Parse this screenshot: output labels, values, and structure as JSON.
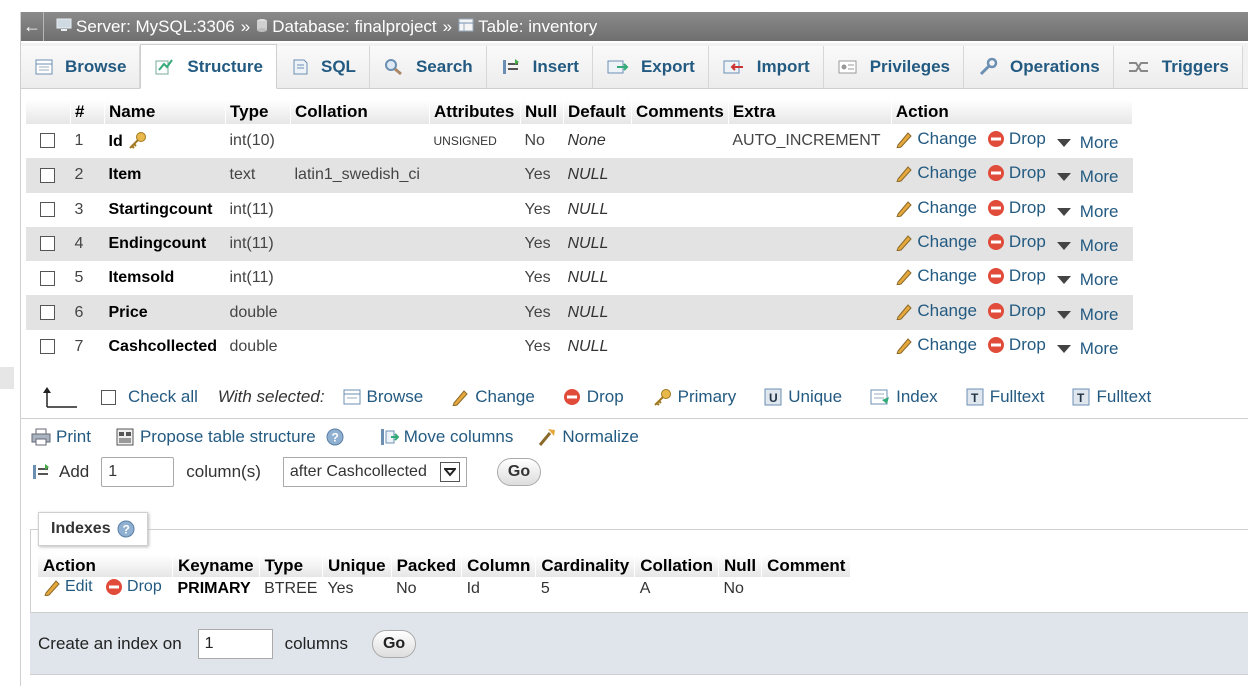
{
  "breadcrumb": {
    "back_arrow": "←",
    "server": "Server: MySQL:3306",
    "database": "Database: finalproject",
    "table": "Table: inventory",
    "separator": "»"
  },
  "tabs": [
    {
      "label": "Browse",
      "icon": "browse-icon",
      "active": false
    },
    {
      "label": "Structure",
      "icon": "structure-icon",
      "active": true
    },
    {
      "label": "SQL",
      "icon": "sql-icon",
      "active": false
    },
    {
      "label": "Search",
      "icon": "search-icon",
      "active": false
    },
    {
      "label": "Insert",
      "icon": "insert-icon",
      "active": false
    },
    {
      "label": "Export",
      "icon": "export-icon",
      "active": false
    },
    {
      "label": "Import",
      "icon": "import-icon",
      "active": false
    },
    {
      "label": "Privileges",
      "icon": "privileges-icon",
      "active": false
    },
    {
      "label": "Operations",
      "icon": "operations-icon",
      "active": false
    },
    {
      "label": "Triggers",
      "icon": "triggers-icon",
      "active": false
    }
  ],
  "structure": {
    "headers": [
      "#",
      "Name",
      "Type",
      "Collation",
      "Attributes",
      "Null",
      "Default",
      "Comments",
      "Extra",
      "Action"
    ],
    "rows": [
      {
        "num": "1",
        "name": "Id",
        "primary_key": true,
        "type": "int(10)",
        "collation": "",
        "attributes": "UNSIGNED",
        "null": "No",
        "default": "None",
        "comments": "",
        "extra": "AUTO_INCREMENT"
      },
      {
        "num": "2",
        "name": "Item",
        "primary_key": false,
        "type": "text",
        "collation": "latin1_swedish_ci",
        "attributes": "",
        "null": "Yes",
        "default": "NULL",
        "comments": "",
        "extra": ""
      },
      {
        "num": "3",
        "name": "Startingcount",
        "primary_key": false,
        "type": "int(11)",
        "collation": "",
        "attributes": "",
        "null": "Yes",
        "default": "NULL",
        "comments": "",
        "extra": ""
      },
      {
        "num": "4",
        "name": "Endingcount",
        "primary_key": false,
        "type": "int(11)",
        "collation": "",
        "attributes": "",
        "null": "Yes",
        "default": "NULL",
        "comments": "",
        "extra": ""
      },
      {
        "num": "5",
        "name": "Itemsold",
        "primary_key": false,
        "type": "int(11)",
        "collation": "",
        "attributes": "",
        "null": "Yes",
        "default": "NULL",
        "comments": "",
        "extra": ""
      },
      {
        "num": "6",
        "name": "Price",
        "primary_key": false,
        "type": "double",
        "collation": "",
        "attributes": "",
        "null": "Yes",
        "default": "NULL",
        "comments": "",
        "extra": ""
      },
      {
        "num": "7",
        "name": "Cashcollected",
        "primary_key": false,
        "type": "double",
        "collation": "",
        "attributes": "",
        "null": "Yes",
        "default": "NULL",
        "comments": "",
        "extra": ""
      }
    ],
    "row_actions": {
      "change": "Change",
      "drop": "Drop",
      "more": "More"
    }
  },
  "bulk": {
    "check_all": "Check all",
    "with_selected": "With selected:",
    "actions": [
      {
        "label": "Browse",
        "icon": "browse-icon"
      },
      {
        "label": "Change",
        "icon": "pencil-icon"
      },
      {
        "label": "Drop",
        "icon": "drop-icon"
      },
      {
        "label": "Primary",
        "icon": "key-icon"
      },
      {
        "label": "Unique",
        "icon": "unique-icon"
      },
      {
        "label": "Index",
        "icon": "index-icon"
      },
      {
        "label": "Fulltext",
        "icon": "fulltext-icon"
      },
      {
        "label": "Fulltext",
        "icon": "fulltext-icon"
      }
    ]
  },
  "links": {
    "print": "Print",
    "propose": "Propose table structure",
    "move_columns": "Move columns",
    "normalize": "Normalize"
  },
  "add_columns": {
    "label": "Add",
    "count_value": "1",
    "unit": "column(s)",
    "position_value": "after Cashcollected",
    "go": "Go"
  },
  "indexes": {
    "legend": "Indexes",
    "headers": [
      "Action",
      "Keyname",
      "Type",
      "Unique",
      "Packed",
      "Column",
      "Cardinality",
      "Collation",
      "Null",
      "Comment"
    ],
    "rows": [
      {
        "edit": "Edit",
        "drop": "Drop",
        "keyname": "PRIMARY",
        "type": "BTREE",
        "unique": "Yes",
        "packed": "No",
        "column": "Id",
        "cardinality": "5",
        "collation": "A",
        "null": "No",
        "comment": ""
      }
    ],
    "create_label": "Create an index on",
    "create_value": "1",
    "create_unit": "columns",
    "create_go": "Go"
  }
}
